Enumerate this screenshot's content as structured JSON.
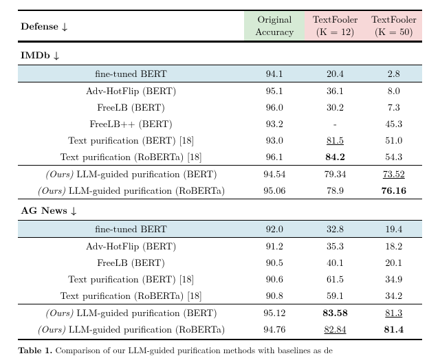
{
  "header": {
    "defense_label": "Defense ↓",
    "orig_line1": "Original",
    "orig_line2": "Accuracy",
    "tf12_line1": "TextFooler",
    "tf12_line2": "(K = 12)",
    "tf50_line1": "TextFooler",
    "tf50_line2": "(K = 50)"
  },
  "sections": {
    "imdb_label": "IMDb ↓",
    "agnews_label": "AG News ↓"
  },
  "imdb": {
    "ft_bert": {
      "name": "fine-tuned BERT",
      "orig": "94.1",
      "k12": "20.4",
      "k50": "2.8"
    },
    "advhotflip": {
      "name": "Adv-HotFlip (BERT)",
      "orig": "95.1",
      "k12": "36.1",
      "k50": "8.0"
    },
    "freelb": {
      "name": "FreeLB (BERT)",
      "orig": "96.0",
      "k12": "30.2",
      "k50": "7.3"
    },
    "freelbpp": {
      "name": "FreeLB++ (BERT)",
      "orig": "93.2",
      "k12": "-",
      "k50": "45.3"
    },
    "tp_bert": {
      "name": "Text purification (BERT)  [18]",
      "orig": "93.0",
      "k12": "81.5",
      "k50": "51.0"
    },
    "tp_roberta": {
      "name": "Text purification (RoBERTa)  [18]",
      "orig": "96.1",
      "k12": "84.2",
      "k50": "54.3"
    },
    "ours_bert": {
      "prefix": "(Ours)",
      "name": " LLM-guided purification (BERT)",
      "orig": "94.54",
      "k12": "79.34",
      "k50": "73.52"
    },
    "ours_roberta": {
      "prefix": "(Ours)",
      "name": " LLM-guided purification (RoBERTa)",
      "orig": "95.06",
      "k12": "78.9",
      "k50": "76.16"
    }
  },
  "agnews": {
    "ft_bert": {
      "name": "fine-tuned BERT",
      "orig": "92.0",
      "k12": "32.8",
      "k50": "19.4"
    },
    "advhotflip": {
      "name": "Adv-HotFlip (BERT)",
      "orig": "91.2",
      "k12": "35.3",
      "k50": "18.2"
    },
    "freelb": {
      "name": "FreeLB (BERT)",
      "orig": "90.5",
      "k12": "40.1",
      "k50": "20.1"
    },
    "tp_bert": {
      "name": "Text purification (BERT)  [18]",
      "orig": "90.6",
      "k12": "61.5",
      "k50": "34.9"
    },
    "tp_roberta": {
      "name": "Text purification (RoBERTa)  [18]",
      "orig": "90.8",
      "k12": "59.1",
      "k50": "34.2"
    },
    "ours_bert": {
      "prefix": "(Ours)",
      "name": " LLM-guided purification (BERT)",
      "orig": "95.12",
      "k12": "83.58",
      "k50": "81.3"
    },
    "ours_roberta": {
      "prefix": "(Ours)",
      "name": " LLM-guided purification (RoBERTa)",
      "orig": "94.76",
      "k12": "82.84",
      "k50": "81.4"
    }
  },
  "caption": {
    "lead": "Table 1.",
    "text": " Comparison of our LLM-guided purification methods with baselines as de"
  },
  "chart_data": {
    "type": "table",
    "title": "Comparison of LLM-guided purification methods with baselines",
    "columns": [
      "Defense",
      "Original Accuracy",
      "TextFooler (K=12)",
      "TextFooler (K=50)"
    ],
    "groups": [
      {
        "name": "IMDb",
        "rows": [
          [
            "fine-tuned BERT",
            94.1,
            20.4,
            2.8
          ],
          [
            "Adv-HotFlip (BERT)",
            95.1,
            36.1,
            8.0
          ],
          [
            "FreeLB (BERT)",
            96.0,
            30.2,
            7.3
          ],
          [
            "FreeLB++ (BERT)",
            93.2,
            null,
            45.3
          ],
          [
            "Text purification (BERT) [18]",
            93.0,
            81.5,
            51.0
          ],
          [
            "Text purification (RoBERTa) [18]",
            96.1,
            84.2,
            54.3
          ],
          [
            "(Ours) LLM-guided purification (BERT)",
            94.54,
            79.34,
            73.52
          ],
          [
            "(Ours) LLM-guided purification (RoBERTa)",
            95.06,
            78.9,
            76.16
          ]
        ]
      },
      {
        "name": "AG News",
        "rows": [
          [
            "fine-tuned BERT",
            92.0,
            32.8,
            19.4
          ],
          [
            "Adv-HotFlip (BERT)",
            91.2,
            35.3,
            18.2
          ],
          [
            "FreeLB (BERT)",
            90.5,
            40.1,
            20.1
          ],
          [
            "Text purification (BERT) [18]",
            90.6,
            61.5,
            34.9
          ],
          [
            "Text purification (RoBERTa) [18]",
            90.8,
            59.1,
            34.2
          ],
          [
            "(Ours) LLM-guided purification (BERT)",
            95.12,
            83.58,
            81.3
          ],
          [
            "(Ours) LLM-guided purification (RoBERTa)",
            94.76,
            82.84,
            81.4
          ]
        ]
      }
    ]
  }
}
